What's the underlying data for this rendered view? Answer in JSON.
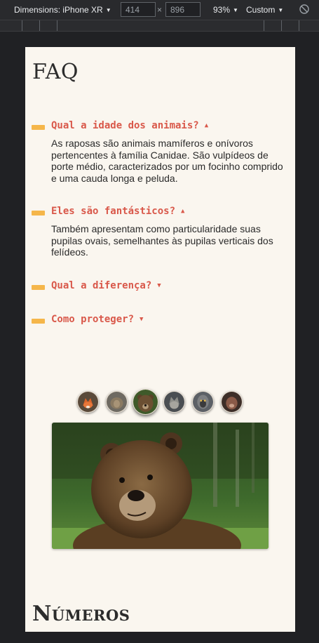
{
  "devtools": {
    "dimensions_label": "Dimensions: iPhone XR",
    "width_value": "414",
    "height_value": "896",
    "times": "×",
    "zoom_label": "93%",
    "throttle_label": "Custom",
    "caret": "▼"
  },
  "page": {
    "faq_title": "FAQ",
    "faq": [
      {
        "question": "Qual a idade dos animais?",
        "arrow": "▲",
        "answer": "As raposas são animais mamíferos e onívoros pertencentes à família Canidae. São vulpídeos de porte médio, caracterizados por um focinho comprido e uma cauda longa e peluda."
      },
      {
        "question": "Eles são fantásticos?",
        "arrow": "▲",
        "answer": "Também apresentam como particularidade suas pupilas ovais, semelhantes às pupilas verticais dos felídeos."
      },
      {
        "question": "Qual a diferença?",
        "arrow": "▼",
        "answer": ""
      },
      {
        "question": "Como proteger?",
        "arrow": "▼",
        "answer": ""
      }
    ],
    "gallery": {
      "thumbnails": [
        "fox",
        "lion",
        "bear",
        "wolf",
        "monkey",
        "dog"
      ],
      "active_index": 2,
      "main_image": "bear"
    },
    "numeros_title": "Números"
  },
  "colors": {
    "page_bg": "#faf6ef",
    "accent_bar": "#f5b64a",
    "question_text": "#d9584a"
  }
}
